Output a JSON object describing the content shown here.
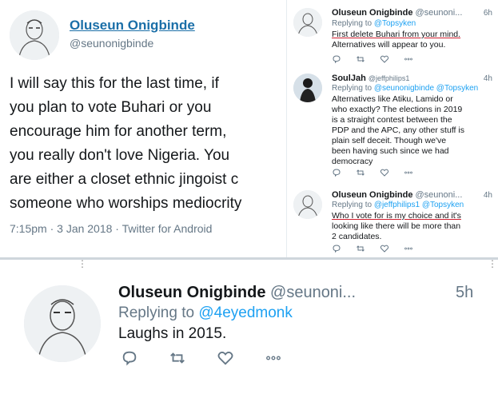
{
  "main_tweet": {
    "name": "Oluseun Onigbinde",
    "handle": "@seunonigbinde",
    "text_lines": [
      "I will say this for the last time, if",
      "you plan to vote Buhari or you",
      "encourage him for another term,",
      "you really don't love Nigeria. You",
      "are either a closet ethnic jingoist c",
      "someone who worships mediocrity"
    ],
    "meta": "7:15pm · 3 Jan 2018 · Twitter for Android"
  },
  "replies": [
    {
      "name": "Oluseun Onigbinde",
      "handle": "@seunoni...",
      "time": "6h",
      "replying_prefix": "Replying to",
      "replying_mentions": "@Topsyken",
      "text_lines": [
        "First delete Buhari from your mind.",
        "Alternatives will appear to you."
      ]
    },
    {
      "name": "SoulJah",
      "handle": "@jeffphilips1",
      "time": "4h",
      "replying_prefix": "Replying to",
      "replying_mentions": "@seunonigbinde @Topsyken",
      "text_lines": [
        "Alternatives like Atiku, Lamido or",
        "who exactly? The elections in 2019",
        "is a straight contest between the",
        "PDP and the APC, any other stuff is",
        "plain self deceit. Though we've",
        "been having such since we had",
        "democracy"
      ]
    },
    {
      "name": "Oluseun Onigbinde",
      "handle": "@seunoni...",
      "time": "4h",
      "replying_prefix": "Replying to",
      "replying_mentions": "@jeffphilips1 @Topsyken",
      "text_lines": [
        "Who I vote for is my choice and it's",
        "looking like there will be more than",
        "2 candidates."
      ]
    }
  ],
  "bottom_tweet": {
    "name": "Oluseun Onigbinde",
    "handle": "@seunoni...",
    "time": "5h",
    "replying_prefix": "Replying to",
    "replying_mention": "@4eyedmonk",
    "text": "Laughs in 2015."
  },
  "icons": [
    "reply-icon",
    "retweet-icon",
    "like-icon",
    "more-icon"
  ],
  "colors": {
    "link_blue": "#1da1f2",
    "name_blue": "#1b6fa8",
    "muted_gray": "#657786",
    "annotation_red": "#d01f2f"
  }
}
